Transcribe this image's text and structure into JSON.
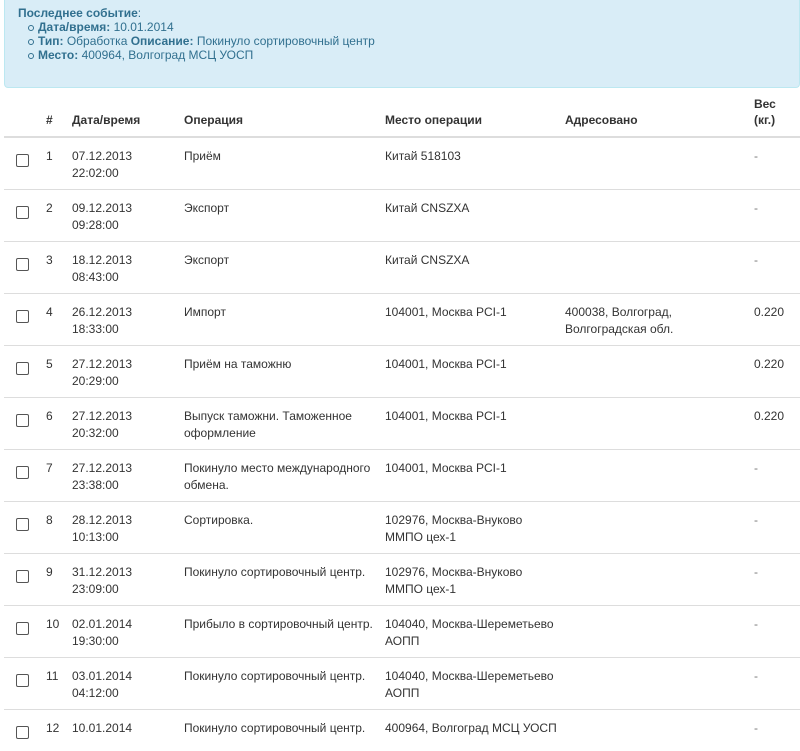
{
  "last_event": {
    "heading": "Последнее событие",
    "colon": ":",
    "datetime_label": "Дата/время:",
    "datetime_value": "10.01.2014",
    "type_label": "Тип:",
    "type_value": "Обработка",
    "desc_label": "Описание:",
    "desc_value": "Покинуло сортировочный центр",
    "place_label": "Место:",
    "place_value": "400964, Волгоград МСЦ УОСП"
  },
  "table": {
    "headers": {
      "num": "#",
      "datetime": "Дата/время",
      "operation": "Операция",
      "place": "Место операции",
      "addressed": "Адресовано",
      "weight": "Вес (кг.)"
    },
    "rows": [
      {
        "n": "1",
        "date": "07.12.2013",
        "time": "22:02:00",
        "op": "Приём",
        "place": "Китай 518103",
        "addr": "",
        "w": "-"
      },
      {
        "n": "2",
        "date": "09.12.2013",
        "time": "09:28:00",
        "op": "Экспорт",
        "place": "Китай CNSZXA",
        "addr": "",
        "w": "-"
      },
      {
        "n": "3",
        "date": "18.12.2013",
        "time": "08:43:00",
        "op": "Экспорт",
        "place": "Китай CNSZXA",
        "addr": "",
        "w": "-"
      },
      {
        "n": "4",
        "date": "26.12.2013",
        "time": "18:33:00",
        "op": "Импорт",
        "place": "104001, Москва PCI-1",
        "addr": "400038, Волгоград, Волгоградская обл.",
        "w": "0.220"
      },
      {
        "n": "5",
        "date": "27.12.2013",
        "time": "20:29:00",
        "op": "Приём на таможню",
        "place": "104001, Москва PCI-1",
        "addr": "",
        "w": "0.220"
      },
      {
        "n": "6",
        "date": "27.12.2013",
        "time": "20:32:00",
        "op": "Выпуск таможни. Таможенное оформление",
        "place": "104001, Москва PCI-1",
        "addr": "",
        "w": "0.220"
      },
      {
        "n": "7",
        "date": "27.12.2013",
        "time": "23:38:00",
        "op": "Покинуло место международного обмена.",
        "place": "104001, Москва PCI-1",
        "addr": "",
        "w": "-"
      },
      {
        "n": "8",
        "date": "28.12.2013",
        "time": "10:13:00",
        "op": "Сортировка.",
        "place": "102976, Москва-Внуково ММПО цех-1",
        "addr": "",
        "w": "-"
      },
      {
        "n": "9",
        "date": "31.12.2013",
        "time": "23:09:00",
        "op": "Покинуло сортировочный центр.",
        "place": "102976, Москва-Внуково ММПО цех-1",
        "addr": "",
        "w": "-"
      },
      {
        "n": "10",
        "date": "02.01.2014",
        "time": "19:30:00",
        "op": "Прибыло в сортировочный центр.",
        "place": "104040, Москва-Шереметьево АОПП",
        "addr": "",
        "w": "-"
      },
      {
        "n": "11",
        "date": "03.01.2014",
        "time": "04:12:00",
        "op": "Покинуло сортировочный центр.",
        "place": "104040, Москва-Шереметьево АОПП",
        "addr": "",
        "w": "-"
      },
      {
        "n": "12",
        "date": "10.01.2014",
        "time": "",
        "op": "Покинуло сортировочный центр.",
        "place": "400964, Волгоград МСЦ УОСП",
        "addr": "",
        "w": "-"
      }
    ]
  }
}
